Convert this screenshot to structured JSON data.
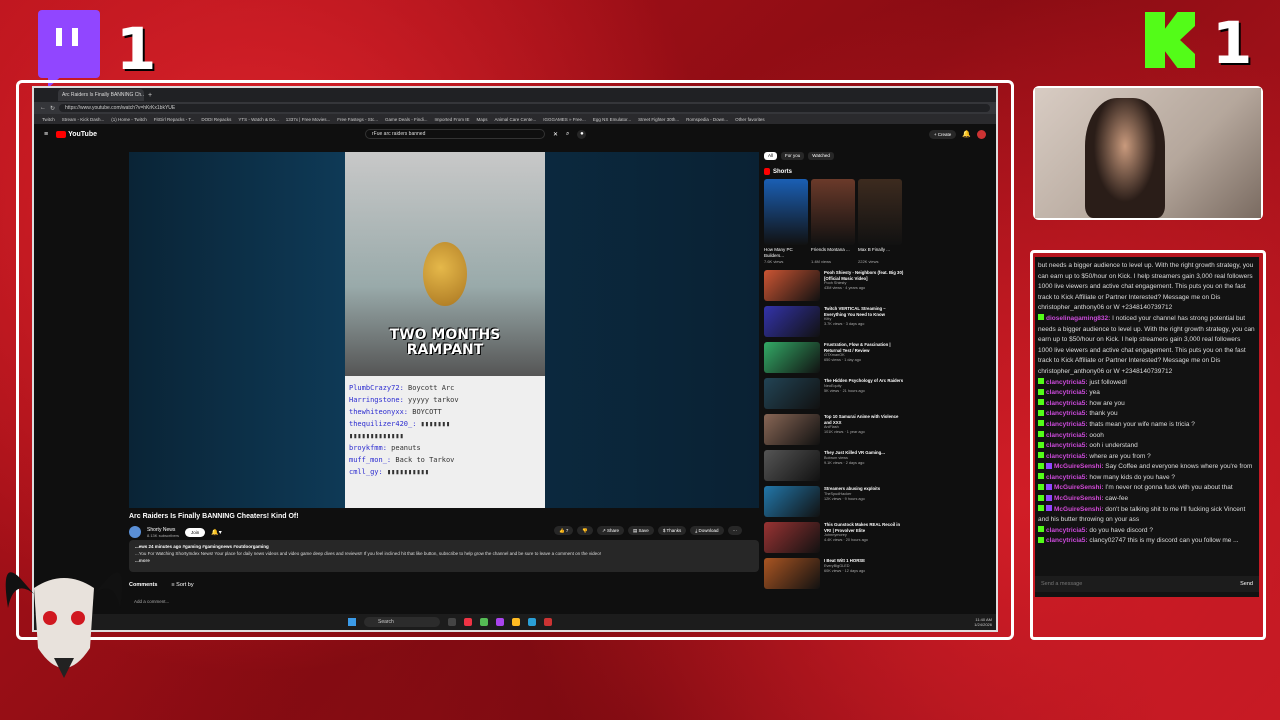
{
  "overlay": {
    "twitch_score": "1",
    "kick_score": "1"
  },
  "browser": {
    "tab_title": "Arc Raiders Is Finally BANNING Ch...",
    "url": "https://www.youtube.com/watch?v=hKrKx1bkYUE",
    "bookmarks": [
      "Twitch",
      "Stream - Kick Dash...",
      "(1) Home - Twitch",
      "FitGirl Repacks - T...",
      "DODI Repacks",
      "YTS - Watch & Do...",
      "1337x | Free Movies...",
      "Free Fastegs - Stc...",
      "Game Deals - Findi...",
      "Imported From IE",
      "Maps",
      "Animal Care Cente...",
      "IGGGAMES » Free...",
      "Egg NS Emulator...",
      "Street Fighter 30th...",
      "Romspedia - Down...",
      "Other favorites"
    ]
  },
  "youtube": {
    "logo_text": "YouTube",
    "search_query": "rFue arc raiders banned",
    "create_label": "Create",
    "video_caption": "TWO MONTHS\nRAMPANT",
    "video_chat": [
      {
        "user": "PlumbCrazy72:",
        "text": "Boycott Arc"
      },
      {
        "user": "Harringstone:",
        "text": "yyyyy tarkov"
      },
      {
        "user": "thewhiteonyxx:",
        "text": "BOYCOTT"
      },
      {
        "user": "thequilizer420_:",
        "text": "▮▮▮▮▮▮▮"
      },
      {
        "user": "",
        "text": "▮▮▮▮▮▮▮▮▮▮▮▮▮"
      },
      {
        "user": "broykfmm:",
        "text": "peanuts"
      },
      {
        "user": "muff_mon_:",
        "text": "Back to Tarkov"
      },
      {
        "user": "cmll_gy:",
        "text": "▮▮▮▮▮▮▮▮▮▮"
      }
    ],
    "video_title": "Arc Raiders Is Finally BANNING Cheaters! Kind Of!",
    "channel_name": "Shorty News",
    "channel_subs": "8.13K subscribers",
    "join_label": "Join",
    "actions": {
      "likes": "7",
      "share": "Share",
      "save": "Save",
      "thanks": "Thanks",
      "download": "Download"
    },
    "description_meta": "...ews 24 minutes ago #gaming #gamingnews #outdoorgaming",
    "description_text": "...You For Watching ShortyIndex News! Your place for daily news videos and video game deep dives and reviews!! If you feel inclined hit that like button, subscribe to help grow the channel and be sure to leave a comment on the video!",
    "description_more": "...more",
    "comments_label": "Comments",
    "sort_label": "Sort by",
    "add_comment": "Add a comment...",
    "chips": [
      "All",
      "For you",
      "Watched"
    ],
    "shorts_title": "Shorts",
    "shorts": [
      {
        "title": "How Many PC Builders...",
        "views": "7.6K views"
      },
      {
        "title": "Friends Montana ...",
        "views": "1.4M views"
      },
      {
        "title": "Max B Finally ...",
        "views": "222K views"
      }
    ],
    "recommended": [
      {
        "title": "Pooh Shiesty - Neighbors (feat. Big 30) [Official Music Video]",
        "channel": "Pooh Shiesty",
        "meta": "43M views · 4 years ago"
      },
      {
        "title": "Twitch VERTICAL Streaming – Everything You Need to Know",
        "channel": "Kitty",
        "meta": "3.7K views · 3 days ago"
      },
      {
        "title": "Frustration, Flow & Fascination | Returnal Test / Review",
        "channel": "GTXmanOK",
        "meta": "650 views · 1 day ago"
      },
      {
        "title": "The Hidden Psychology of Arc Raiders",
        "channel": "NeoEquity",
        "meta": "5K views · 21 hours ago"
      },
      {
        "title": "Top 10 Samurai Anime with Violence and XXX",
        "channel": "AniFlash",
        "meta": "101K views · 1 year ago"
      },
      {
        "title": "They Just Killed VR Gaming...",
        "channel": "Bobrum views",
        "meta": "9.1K views · 2 days ago"
      },
      {
        "title": "Streamers abusing exploits",
        "channel": "TheSpudHacker",
        "meta": "12K views · 9 hours ago"
      },
      {
        "title": "This Gunstock Makes REAL Recoil in VR! | Provolver Elite",
        "channel": "Johnnymorey",
        "meta": "4.4K views · 20 hours ago"
      },
      {
        "title": "I Beat Witt 1 HORSE",
        "channel": "EveryBigGLED",
        "meta": "60K views · 12 days ago"
      }
    ]
  },
  "taskbar": {
    "search_placeholder": "Search",
    "time": "11:40 AM",
    "date": "1/24/2026"
  },
  "chat": {
    "lines": [
      {
        "user": "",
        "text": "but needs a bigger audience to level up. With the right growth strategy, you can earn up to $50/hour on Kick. I help streamers gain 3,000 real followers 1000 live viewers and active chat engagement. This puts you on the fast track to Kick Affiliate or Partner Interested? Message me on Dis christopher_anthony06 or W +2348140739712"
      },
      {
        "user": "dioselinagaming832:",
        "text": "I noticed your channel has strong potential but needs a bigger audience to level up. With the right growth strategy, you can earn up to $50/hour on Kick. I help streamers gain 3,000 real followers 1000 live viewers and active chat engagement. This puts you on the fast track to Kick Affiliate or Partner Interested? Message me on Dis christopher_anthony06 or W +2348140739712"
      },
      {
        "user": "clancytricia5:",
        "text": "just followed!"
      },
      {
        "user": "clancytricia5:",
        "text": "yea"
      },
      {
        "user": "clancytricia5:",
        "text": "how are you"
      },
      {
        "user": "clancytricia5:",
        "text": "thank you"
      },
      {
        "user": "clancytricia5:",
        "text": "thats mean your wife name is tricia ?"
      },
      {
        "user": "clancytricia5:",
        "text": "oooh"
      },
      {
        "user": "clancytricia5:",
        "text": "ooh i understand"
      },
      {
        "user": "clancytricia5:",
        "text": "where are you from ?"
      },
      {
        "user": "McGuireSenshi:",
        "text": "Say Coffee and everyone knows where you're from"
      },
      {
        "user": "clancytricia5:",
        "text": "how many kids do you have ?"
      },
      {
        "user": "McGuireSenshi:",
        "text": "I'm never not gonna fuck with you about that"
      },
      {
        "user": "McGuireSenshi:",
        "text": "caw-fee"
      },
      {
        "user": "McGuireSenshi:",
        "text": "don't be talking shit to me I'll fucking sick Vincent and his butter throwing on your ass"
      },
      {
        "user": "clancytricia5:",
        "text": "do you have discord ?"
      },
      {
        "user": "clancytricia5:",
        "text": "clancy02747 this is my discord can you follow me ..."
      }
    ],
    "input_placeholder": "Send a message",
    "send_label": "Send"
  }
}
